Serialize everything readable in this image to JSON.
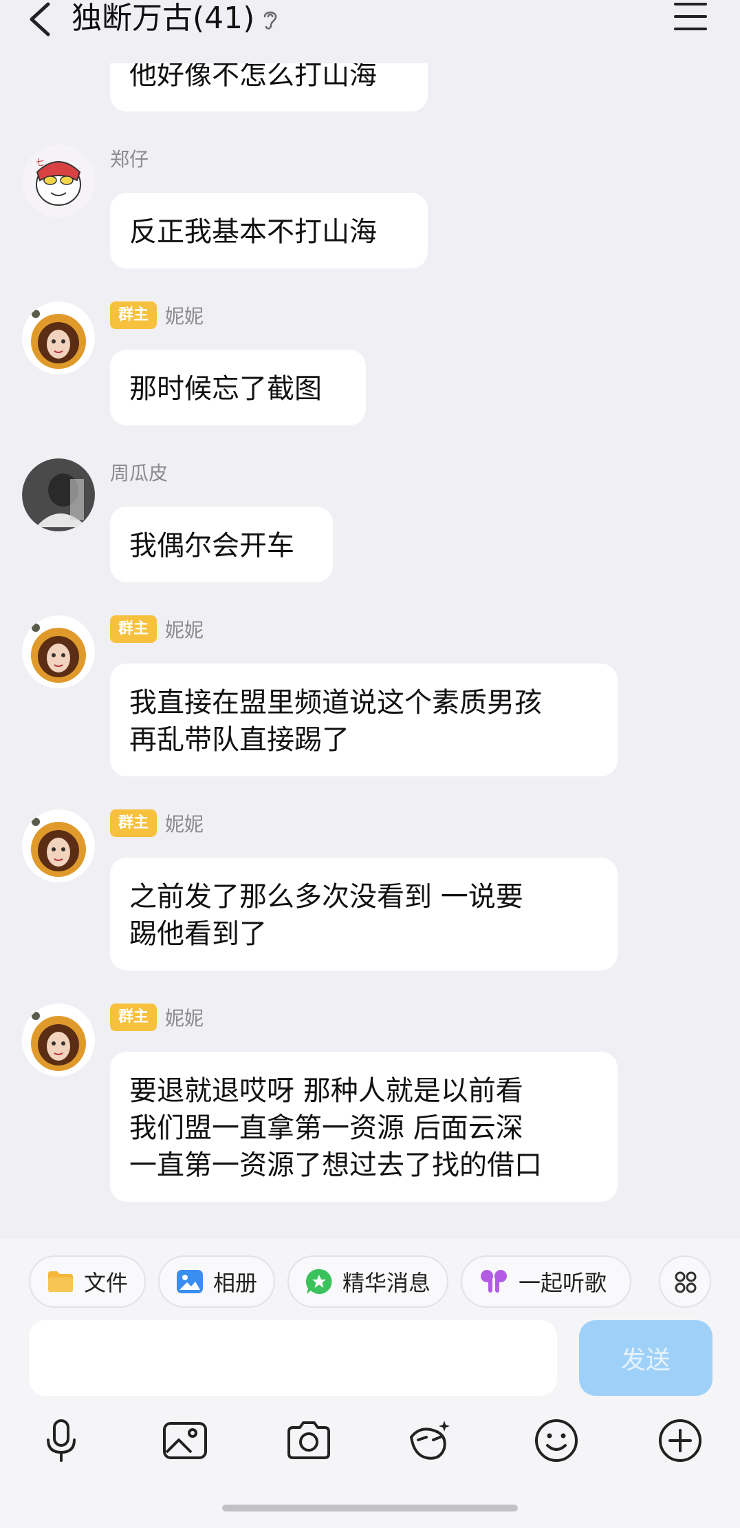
{
  "header": {
    "title": "独断万古(41)"
  },
  "messages": [
    {
      "type": "partial",
      "text": "他好像不怎么打山海"
    },
    {
      "sender": "郑仔",
      "badge": "",
      "text": "反正我基本不打山海",
      "avatar": "cartoon-avatar"
    },
    {
      "sender": "妮妮",
      "badge": "群主",
      "text": "那时候忘了截图",
      "avatar": "girl-avatar"
    },
    {
      "sender": "周瓜皮",
      "badge": "",
      "text": "我偶尔会开车",
      "avatar": "dark-avatar"
    },
    {
      "sender": "妮妮",
      "badge": "群主",
      "text": "我直接在盟里频道说这个素质男孩\n再乱带队直接踢了",
      "avatar": "girl-avatar"
    },
    {
      "sender": "妮妮",
      "badge": "群主",
      "text": "之前发了那么多次没看到 一说要\n踢他看到了",
      "avatar": "girl-avatar"
    },
    {
      "sender": "妮妮",
      "badge": "群主",
      "text": "要退就退哎呀 那种人就是以前看\n我们盟一直拿第一资源 后面云深\n一直第一资源了想过去了找的借口",
      "avatar": "girl-avatar"
    }
  ],
  "quick_actions": [
    {
      "label": "文件",
      "icon": "folder-icon",
      "color": "#f4b73a"
    },
    {
      "label": "相册",
      "icon": "photo-album-icon",
      "color": "#3a8ef0"
    },
    {
      "label": "精华消息",
      "icon": "star-bubble-icon",
      "color": "#3cc25c"
    },
    {
      "label": "一起听歌",
      "icon": "earbuds-icon",
      "color": "#b25ce6"
    }
  ],
  "composer": {
    "send_label": "发送",
    "placeholder": ""
  },
  "bottom_icons": [
    "microphone-icon",
    "image-icon",
    "camera-icon",
    "sticker-icon",
    "emoji-icon",
    "plus-circle-icon"
  ]
}
